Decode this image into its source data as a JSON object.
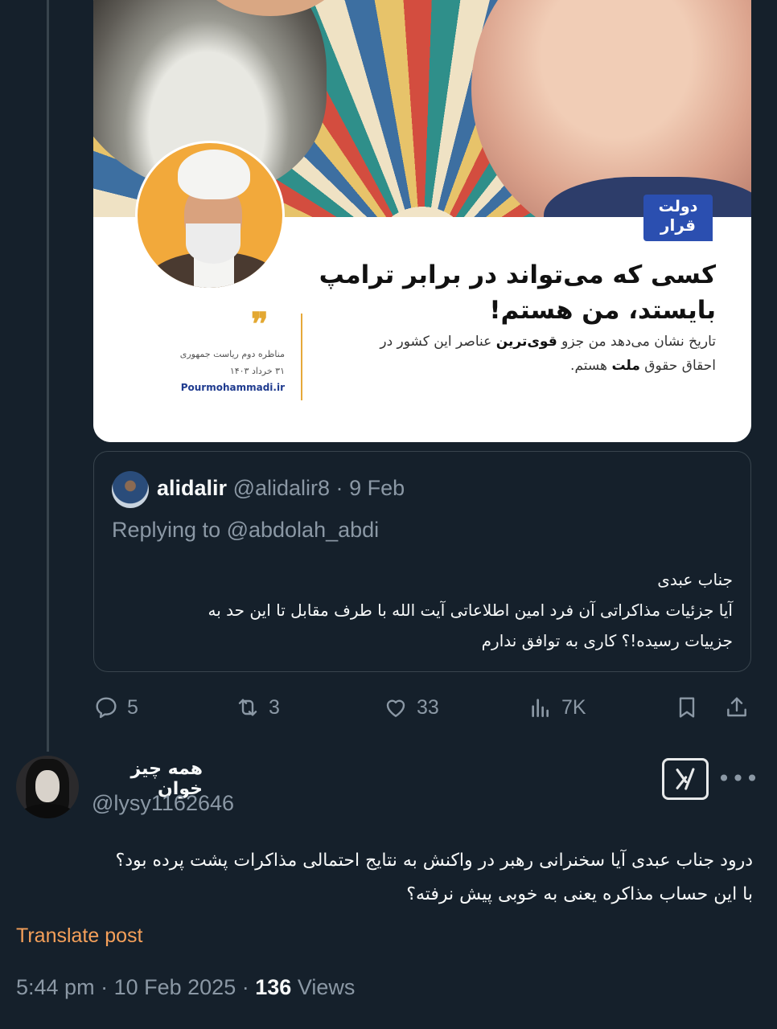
{
  "poster": {
    "logo_line1": "دولت",
    "logo_line2": "قرار",
    "headline_line1": "کسی که می‌تواند در برابر ترامپ",
    "headline_line2": "بایستد، من هستم!",
    "subline_line1_pre": "تاریخ نشان می‌دهد من جزو ",
    "subline_line1_strong": "قوی‌ترین",
    "subline_line1_post": " عناصر این کشور در",
    "subline_line2_pre": "احقاق حقوق ",
    "subline_line2_strong": "ملت",
    "subline_line2_post": " هستم.",
    "meta_line1": "مناظره دوم ریاست جمهوری",
    "meta_line2": "۳۱ خرداد ۱۴۰۳",
    "url": "Pourmohammadi.ir"
  },
  "quoted_tweet": {
    "name": "alidalir",
    "handle": "@alidalir8",
    "separator": "·",
    "date": "9 Feb",
    "replying_to": "Replying to @abdolah_abdi",
    "body_line1": "جناب عبدی",
    "body_line2": "آیا جزئیات مذاکراتی آن فرد امین اطلاعاتی آیت الله با طرف مقابل تا این حد به",
    "body_line3": "جزییات رسیده!؟ کاری به توافق ندارم"
  },
  "actions": {
    "replies": "5",
    "reposts": "3",
    "likes": "33",
    "views": "7K"
  },
  "main_tweet": {
    "display_name": "همه چیز خوان",
    "handle": "@lysy1162646",
    "body_line1": "درود جناب عبدی آیا سخنرانی رهبر در واکنش به نتایج احتمالی مذاکرات پشت پرده بود؟",
    "body_line2": "با این حساب مذاکره یعنی به خوبی پیش نرفته؟",
    "translate_label": "Translate post",
    "time": "5:44 pm",
    "dot1": "·",
    "date": "10 Feb 2025",
    "dot2": "·",
    "views_count": "136",
    "views_label": "Views"
  },
  "colors": {
    "background": "#15202b",
    "border": "#38444d",
    "secondary_text": "#8b98a5",
    "translate_link": "#f5a05a",
    "poster_accent": "#e6a93a",
    "poster_logo": "#2b4fb0"
  },
  "icons": [
    "reply-icon",
    "repost-icon",
    "like-icon",
    "views-icon",
    "bookmark-icon",
    "share-icon",
    "grok-icon",
    "more-icon"
  ]
}
